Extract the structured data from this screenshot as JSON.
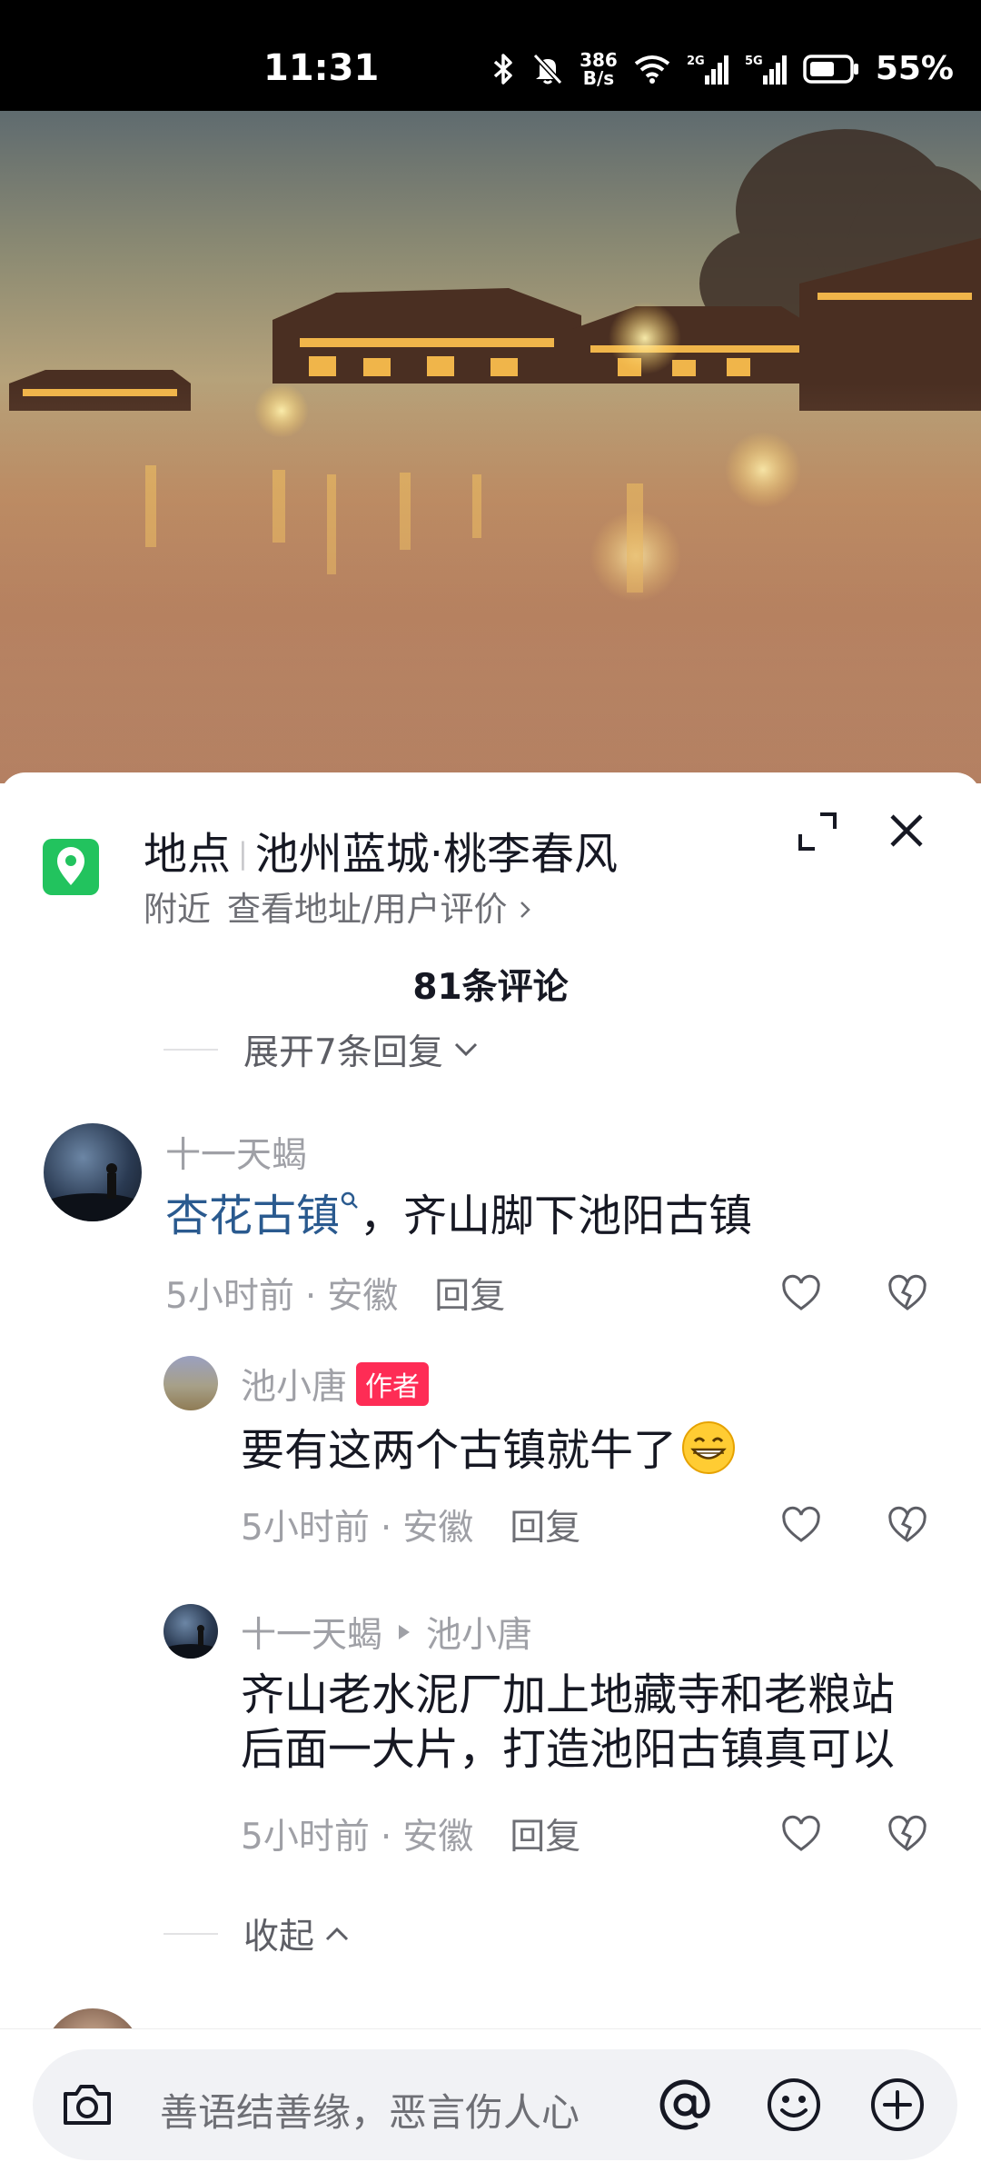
{
  "status_bar": {
    "time": "11:31",
    "net_speed_value": "386",
    "net_speed_unit": "B/s",
    "signal_1_label": "2G",
    "signal_2_label": "5G",
    "battery": "55%",
    "icons": [
      "bluetooth-icon",
      "mute-icon",
      "wifi-icon",
      "signal-icon",
      "battery-icon"
    ]
  },
  "location": {
    "prefix": "地点",
    "name": "池州蓝城·桃李春风",
    "nearby": "附近",
    "link": "查看地址/用户评价",
    "pin_color": "#22c35e"
  },
  "comments_header": {
    "count_text": "81条评论",
    "expand_replies": "展开7条回复",
    "collapse": "收起"
  },
  "comments": [
    {
      "user": "十一天蝎",
      "text_highlight": "杏花古镇",
      "text_rest": "，齐山脚下池阳古镇",
      "time": "5小时前",
      "region": "安徽",
      "reply_label": "回复"
    },
    {
      "user": "池小唐",
      "badge": "作者",
      "text": "要有这两个古镇就牛了",
      "time": "5小时前",
      "region": "安徽",
      "reply_label": "回复"
    },
    {
      "user": "十一天蝎",
      "reply_to": "池小唐",
      "text_line1": "齐山老水泥厂加上地藏寺和老粮站",
      "text_line2": "后面一大片，打造池阳古镇真可以",
      "time": "5小时前",
      "region": "安徽",
      "reply_label": "回复"
    }
  ],
  "input_bar": {
    "placeholder": "善语结善缘，恶言伤人心",
    "icons": [
      "camera-icon",
      "at-icon",
      "emoji-icon",
      "plus-icon"
    ]
  },
  "colors": {
    "author_badge": "#fe2c55",
    "topic_link": "#2a5a8f"
  }
}
